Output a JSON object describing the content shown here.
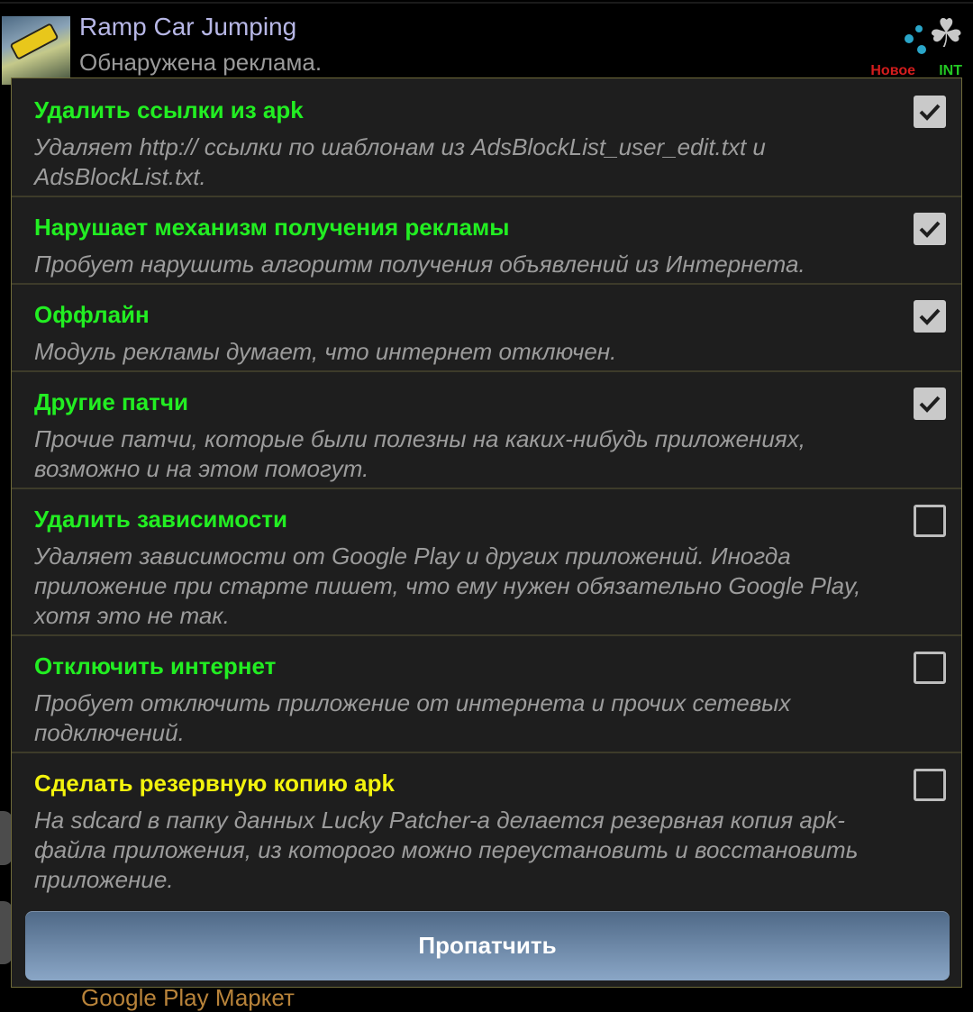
{
  "background": {
    "app_title": "Ramp Car Jumping",
    "app_subtitle": "Обнаружена реклама.",
    "badge_new": "Новое",
    "badge_int": "INT",
    "bottom_item_text": "Google Play Маркет"
  },
  "dialog": {
    "options": [
      {
        "title": "Удалить ссылки из apk",
        "description": "Удаляет http:// ссылки по шаблонам из AdsBlockList_user_edit.txt и AdsBlockList.txt.",
        "checked": true
      },
      {
        "title": "Нарушает механизм получения рекламы",
        "description": "Пробует нарушить алгоритм получения объявлений из Интернета.",
        "checked": true
      },
      {
        "title": "Оффлайн",
        "description": "Модуль рекламы думает, что интернет отключен.",
        "checked": true
      },
      {
        "title": "Другие патчи",
        "description": "Прочие патчи, которые были полезны на каких-нибудь приложениях, возможно и на этом помогут.",
        "checked": true
      },
      {
        "title": "Удалить зависимости",
        "description": "Удаляет зависимости от Google Play и других приложений. Иногда приложение при старте пишет, что ему нужен обязательно Google Play, хотя это не так.",
        "checked": false
      },
      {
        "title": "Отключить интернет",
        "description": "Пробует отключить приложение от интернета и прочих сетевых подключений.",
        "checked": false
      },
      {
        "title": "Сделать резервную копию apk",
        "description": "На sdcard в папку данных Lucky Patcher-а делается резервная копия apk-файла приложения, из которого можно переустановить и восстановить приложение.",
        "checked": false
      }
    ],
    "patch_button_label": "Пропатчить"
  },
  "colors": {
    "title_green": "#22ee22",
    "title_yellow": "#f3f30d",
    "description_gray": "#9c9c9c",
    "dialog_bg": "#1e1e1e",
    "button_gradient_top": "#4f6987",
    "button_gradient_bottom": "#8aa6c6"
  }
}
